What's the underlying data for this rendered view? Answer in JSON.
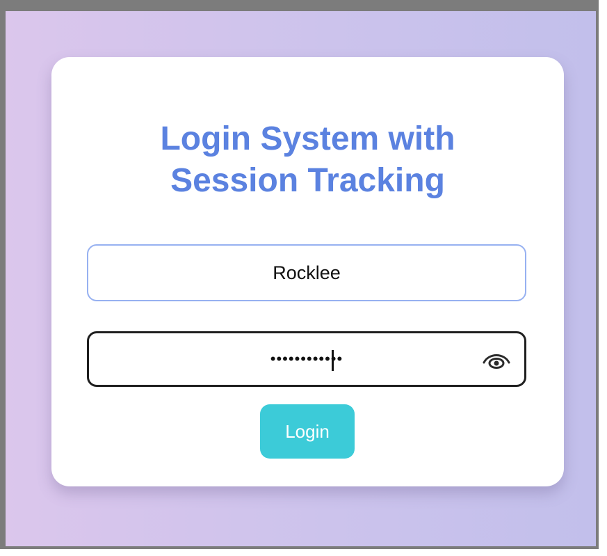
{
  "login": {
    "title": "Login System with\nSession Tracking",
    "username_value": "Rocklee",
    "password_mask": "••••••••••••",
    "button_label": "Login"
  },
  "icons": {
    "password_toggle": "eye-icon"
  },
  "colors": {
    "title": "#5b82e0",
    "button": "#3ccbd8",
    "username_border": "#97b1f1",
    "background_start": "#dbc6ec",
    "background_end": "#c2bfeb"
  }
}
